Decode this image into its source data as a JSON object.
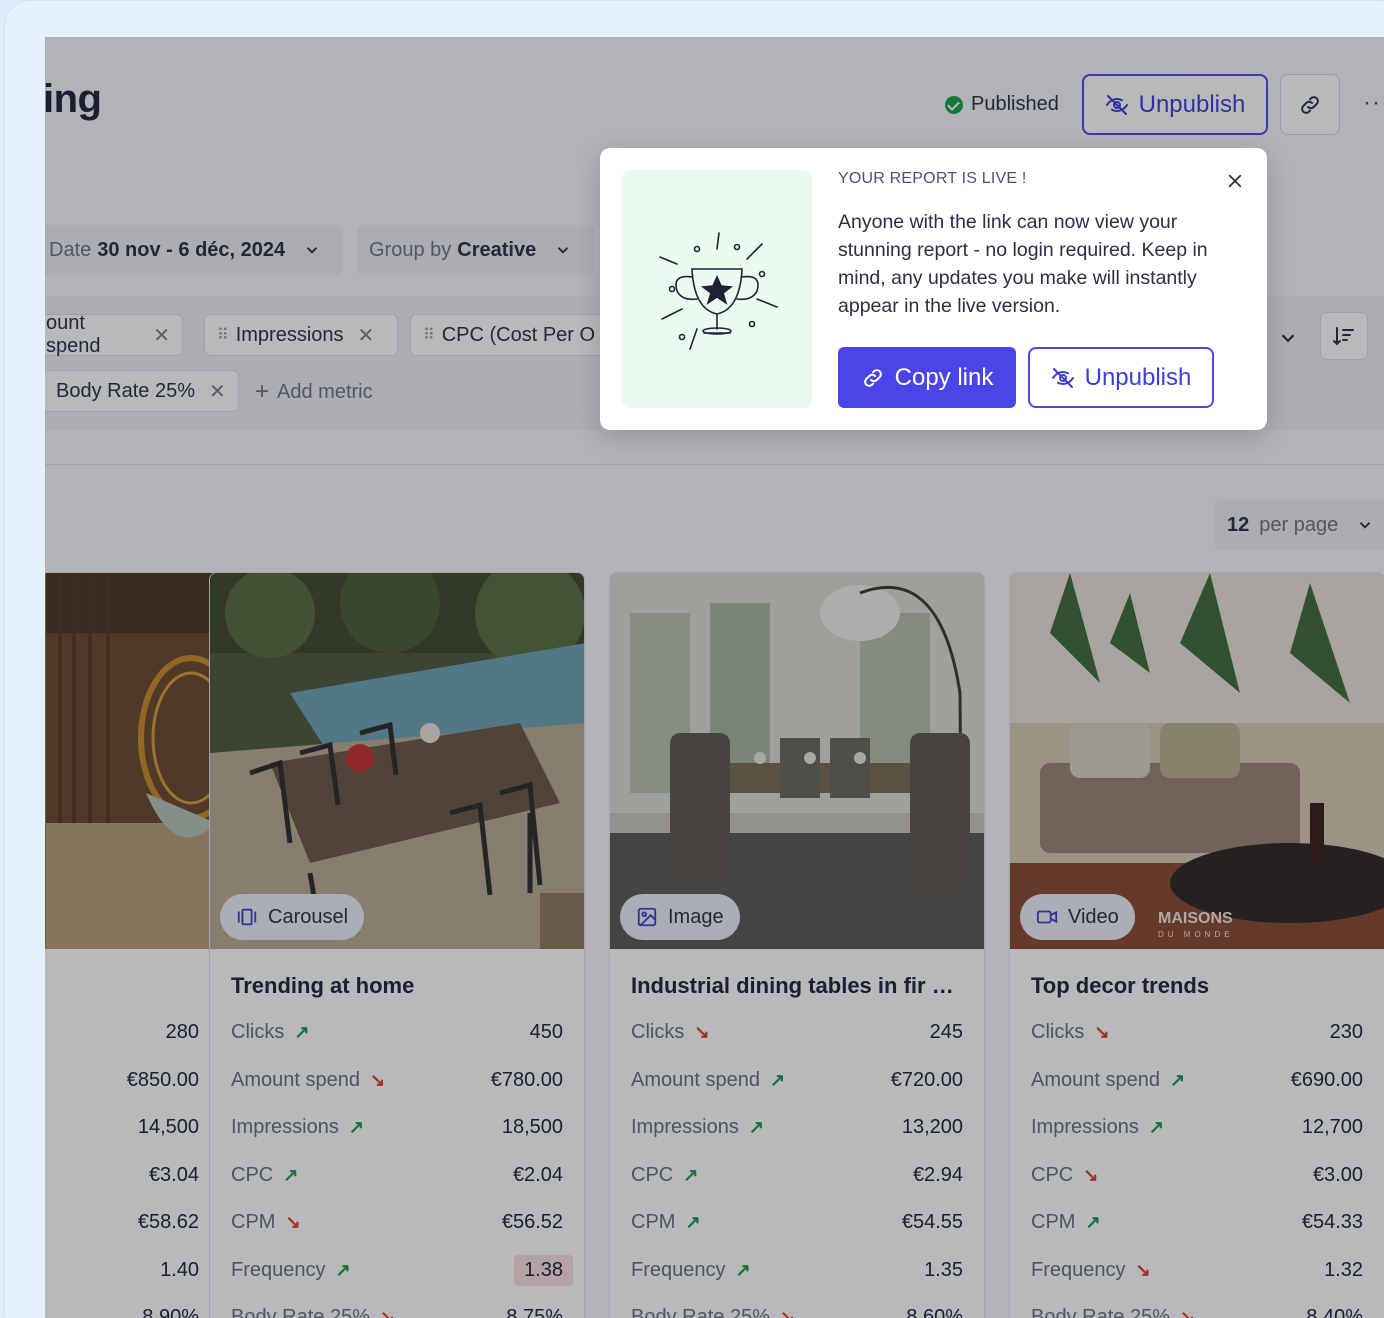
{
  "header": {
    "title": "ing",
    "status": "Published",
    "unpublish_label": "Unpublish",
    "more_label": "···"
  },
  "filters": {
    "date_label": "Date",
    "date_value": "30 nov - 6 déc, 2024",
    "group_label": "Group by",
    "group_value": "Creative",
    "per_page_value": "12",
    "per_page_label": "per page"
  },
  "metrics_chips": [
    {
      "label": "ount spend"
    },
    {
      "label": "Impressions"
    },
    {
      "label": "CPC (Cost Per O"
    },
    {
      "label": "Body Rate 25%"
    }
  ],
  "add_metric_label": "Add metric",
  "popup": {
    "eyebrow": "YOUR REPORT IS LIVE !",
    "body": "Anyone with the link can now view your stunning report - no login required. Keep in mind, any updates you make will instantly appear in the live version.",
    "copy_label": "Copy link",
    "unpublish_label": "Unpublish"
  },
  "cards": [
    {
      "title": "",
      "badge": "",
      "rows": [
        {
          "label": "",
          "value": "280"
        },
        {
          "label": "",
          "value": "€850.00"
        },
        {
          "label": "",
          "value": "14,500"
        },
        {
          "label": "",
          "value": "€3.04"
        },
        {
          "label": "",
          "value": "€58.62"
        },
        {
          "label": "",
          "value": "1.40"
        },
        {
          "label": "",
          "value": "8.90%"
        }
      ]
    },
    {
      "title": "Trending at home",
      "badge": "Carousel",
      "rows": [
        {
          "label": "Clicks",
          "trend": "up",
          "value": "450"
        },
        {
          "label": "Amount spend",
          "trend": "down",
          "value": "€780.00"
        },
        {
          "label": "Impressions",
          "trend": "up",
          "value": "18,500"
        },
        {
          "label": "CPC",
          "trend": "up",
          "value": "€2.04"
        },
        {
          "label": "CPM",
          "trend": "down",
          "value": "€56.52"
        },
        {
          "label": "Frequency",
          "trend": "up",
          "value": "1.38"
        },
        {
          "label": "Body Rate 25%",
          "trend": "down",
          "value": "8.75%"
        }
      ]
    },
    {
      "title": "Industrial dining tables in fir w...",
      "badge": "Image",
      "rows": [
        {
          "label": "Clicks",
          "trend": "down",
          "value": "245"
        },
        {
          "label": "Amount spend",
          "trend": "up",
          "value": "€720.00"
        },
        {
          "label": "Impressions",
          "trend": "up",
          "value": "13,200"
        },
        {
          "label": "CPC",
          "trend": "up",
          "value": "€2.94"
        },
        {
          "label": "CPM",
          "trend": "up",
          "value": "€54.55"
        },
        {
          "label": "Frequency",
          "trend": "up",
          "value": "1.35"
        },
        {
          "label": "Body Rate 25%",
          "trend": "down",
          "value": "8.60%"
        }
      ]
    },
    {
      "title": "Top decor trends",
      "badge": "Video",
      "rows": [
        {
          "label": "Clicks",
          "trend": "down",
          "value": "230"
        },
        {
          "label": "Amount spend",
          "trend": "up",
          "value": "€690.00"
        },
        {
          "label": "Impressions",
          "trend": "up",
          "value": "12,700"
        },
        {
          "label": "CPC",
          "trend": "down",
          "value": "€3.00"
        },
        {
          "label": "CPM",
          "trend": "up",
          "value": "€54.33"
        },
        {
          "label": "Frequency",
          "trend": "down",
          "value": "1.32"
        },
        {
          "label": "Body Rate 25%",
          "trend": "down",
          "value": "8.40%"
        }
      ]
    }
  ],
  "image_text": {
    "brand": "MAISONS",
    "brand_sub": "DU MONDE"
  },
  "icons": {
    "check": "check-circle-icon",
    "eye_off": "eye-off-icon",
    "link": "link-icon",
    "chevron": "chevron-down-icon",
    "close": "close-icon",
    "grip": "drag-handle-icon",
    "plus": "plus-icon",
    "sort": "sort-icon",
    "trophy": "trophy-illustration",
    "carousel": "carousel-icon",
    "image": "image-icon",
    "video": "video-icon"
  },
  "colors": {
    "accent": "#4b45e8",
    "success": "#18a34a",
    "trend_up": "#1a9a45",
    "trend_down": "#e03b2b",
    "highlight": "#fadfe0"
  }
}
